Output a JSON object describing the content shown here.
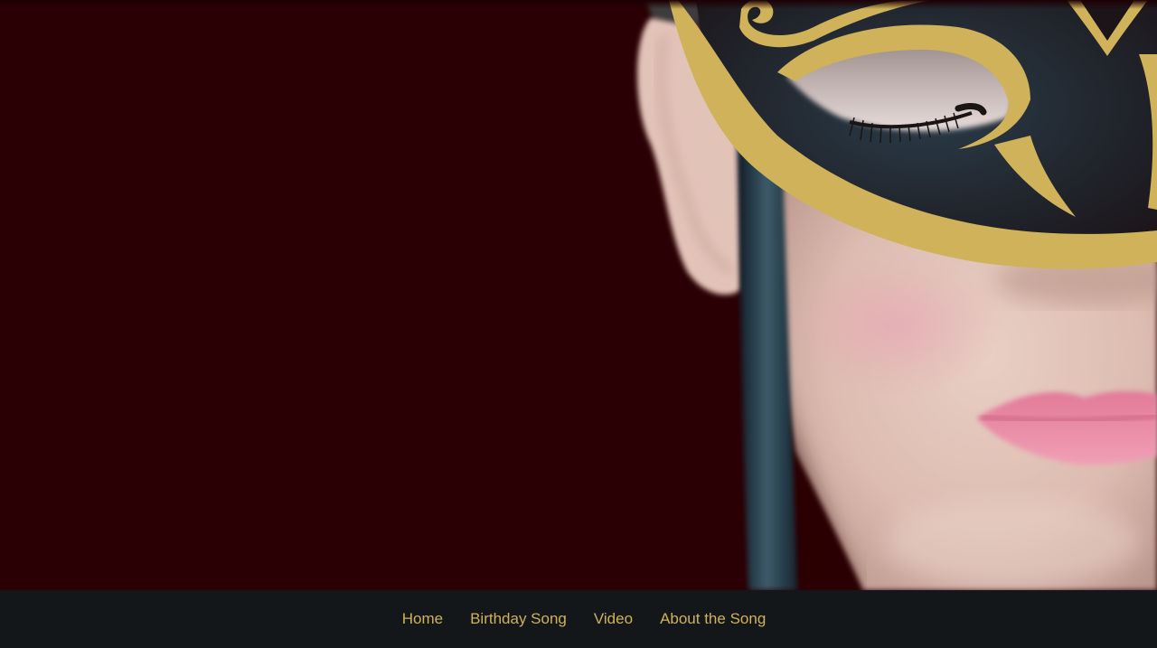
{
  "nav": {
    "items": [
      {
        "label": "Home"
      },
      {
        "label": "Birthday Song"
      },
      {
        "label": "Video"
      },
      {
        "label": "About the Song"
      }
    ]
  },
  "hero": {
    "image": "masquerade-mask-woman-portrait"
  },
  "colors": {
    "background": "#2b0004",
    "nav_background": "#141719",
    "nav_link": "#cfb25a",
    "mask_gold": "#cfb25a"
  }
}
